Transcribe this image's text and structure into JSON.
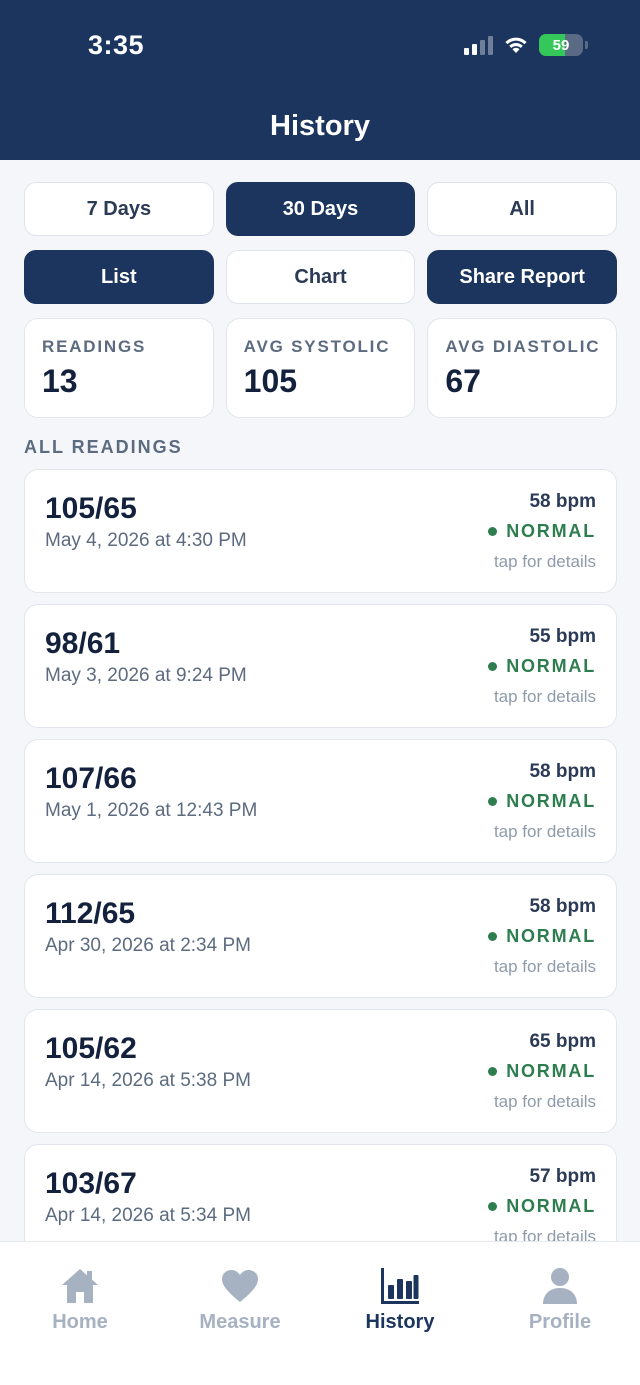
{
  "status_bar": {
    "time": "3:35",
    "battery": "59",
    "battery_level": 0.59
  },
  "header": {
    "title": "History"
  },
  "range_tabs": [
    {
      "label": "7 Days",
      "active": false
    },
    {
      "label": "30 Days",
      "active": true
    },
    {
      "label": "All",
      "active": false
    }
  ],
  "view_tabs": [
    {
      "label": "List",
      "active": true
    },
    {
      "label": "Chart",
      "active": false
    },
    {
      "label": "Share Report",
      "active": true
    }
  ],
  "stats": {
    "readings": {
      "label": "READINGS",
      "value": "13"
    },
    "avg_systolic": {
      "label": "AVG SYSTOLIC",
      "value": "105"
    },
    "avg_diastolic": {
      "label": "AVG DIASTOLIC",
      "value": "67"
    }
  },
  "section_label": "ALL READINGS",
  "readings": [
    {
      "bp": "105/65",
      "date": "May 4, 2026 at 4:30 PM",
      "pulse": "58 bpm",
      "category": "NORMAL",
      "hint": "tap for details"
    },
    {
      "bp": "98/61",
      "date": "May 3, 2026 at 9:24 PM",
      "pulse": "55 bpm",
      "category": "NORMAL",
      "hint": "tap for details"
    },
    {
      "bp": "107/66",
      "date": "May 1, 2026 at 12:43 PM",
      "pulse": "58 bpm",
      "category": "NORMAL",
      "hint": "tap for details"
    },
    {
      "bp": "112/65",
      "date": "Apr 30, 2026 at 2:34 PM",
      "pulse": "58 bpm",
      "category": "NORMAL",
      "hint": "tap for details"
    },
    {
      "bp": "105/62",
      "date": "Apr 14, 2026 at 5:38 PM",
      "pulse": "65 bpm",
      "category": "NORMAL",
      "hint": "tap for details"
    },
    {
      "bp": "103/67",
      "date": "Apr 14, 2026 at 5:34 PM",
      "pulse": "57 bpm",
      "category": "NORMAL",
      "hint": "tap for details"
    }
  ],
  "tab_bar": [
    {
      "label": "Home",
      "icon": "home-icon",
      "active": false
    },
    {
      "label": "Measure",
      "icon": "heart-icon",
      "active": false
    },
    {
      "label": "History",
      "icon": "bar-chart-icon",
      "active": true
    },
    {
      "label": "Profile",
      "icon": "person-icon",
      "active": false
    }
  ],
  "colors": {
    "primary": "#1c355e",
    "normal_status": "#2e7d4f",
    "background": "#f4f6f9",
    "inactive_tab": "#a6b1c1"
  }
}
